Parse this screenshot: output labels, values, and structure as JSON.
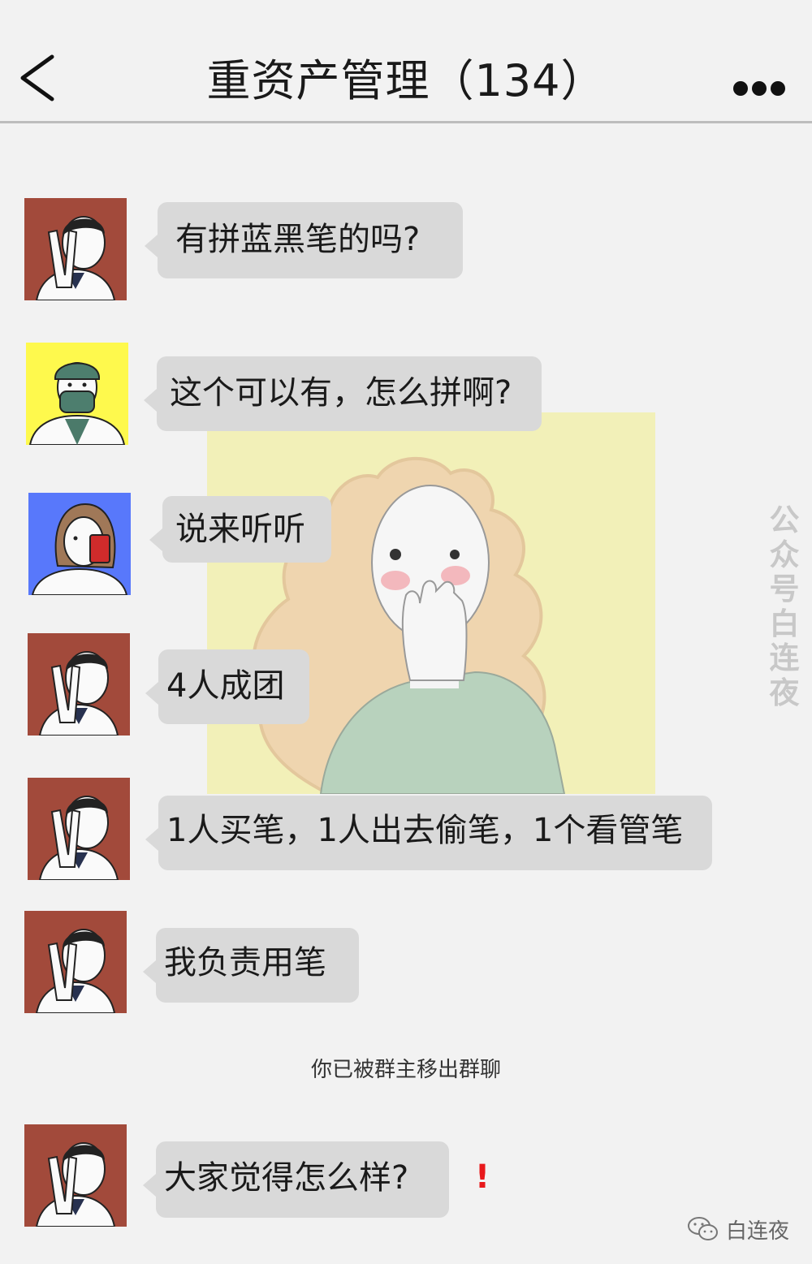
{
  "header": {
    "title": "重资产管理（134）",
    "back_icon": "chevron-left-icon",
    "more_icon": "more-dots-icon"
  },
  "watermark": "公众号白连夜",
  "messages": [
    {
      "sender": "mustache-doctor",
      "text": "有拼蓝黑笔的吗?"
    },
    {
      "sender": "masked-surgeon",
      "text": "这个可以有，怎么拼啊?"
    },
    {
      "sender": "nurse-with-drink",
      "text": "说来听听"
    },
    {
      "sender": "mustache-doctor",
      "text": "4人成团"
    },
    {
      "sender": "mustache-doctor",
      "text": "1人买笔，1人出去偷笔，1个看管笔"
    },
    {
      "sender": "mustache-doctor",
      "text": "我负责用笔"
    },
    {
      "sender": "mustache-doctor",
      "text": "大家觉得怎么样?"
    }
  ],
  "system_note": "你已被群主移出群聊",
  "error_mark": "!",
  "footer": {
    "brand": "白连夜",
    "icon": "wechat-icon"
  },
  "colors": {
    "background": "#f2f2f2",
    "bubble": "#d9d9d9",
    "avatar_brown": "#a24a3b",
    "avatar_yellow": "#fef94d",
    "avatar_blue": "#5878fb",
    "illustration_bg": "#f2f0b8",
    "error": "#e8191c"
  }
}
